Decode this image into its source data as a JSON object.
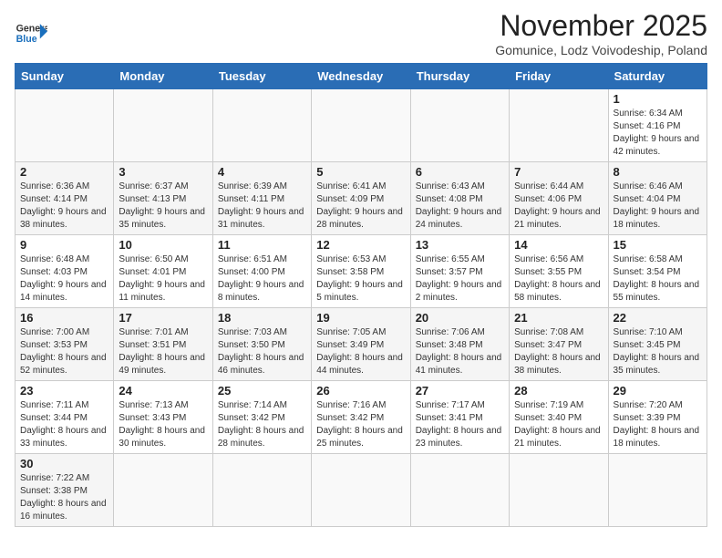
{
  "header": {
    "logo_general": "General",
    "logo_blue": "Blue",
    "month_title": "November 2025",
    "subtitle": "Gomunice, Lodz Voivodeship, Poland"
  },
  "days_of_week": [
    "Sunday",
    "Monday",
    "Tuesday",
    "Wednesday",
    "Thursday",
    "Friday",
    "Saturday"
  ],
  "weeks": [
    {
      "days": [
        {
          "num": "",
          "info": ""
        },
        {
          "num": "",
          "info": ""
        },
        {
          "num": "",
          "info": ""
        },
        {
          "num": "",
          "info": ""
        },
        {
          "num": "",
          "info": ""
        },
        {
          "num": "",
          "info": ""
        },
        {
          "num": "1",
          "info": "Sunrise: 6:34 AM\nSunset: 4:16 PM\nDaylight: 9 hours\nand 42 minutes."
        }
      ]
    },
    {
      "days": [
        {
          "num": "2",
          "info": "Sunrise: 6:36 AM\nSunset: 4:14 PM\nDaylight: 9 hours\nand 38 minutes."
        },
        {
          "num": "3",
          "info": "Sunrise: 6:37 AM\nSunset: 4:13 PM\nDaylight: 9 hours\nand 35 minutes."
        },
        {
          "num": "4",
          "info": "Sunrise: 6:39 AM\nSunset: 4:11 PM\nDaylight: 9 hours\nand 31 minutes."
        },
        {
          "num": "5",
          "info": "Sunrise: 6:41 AM\nSunset: 4:09 PM\nDaylight: 9 hours\nand 28 minutes."
        },
        {
          "num": "6",
          "info": "Sunrise: 6:43 AM\nSunset: 4:08 PM\nDaylight: 9 hours\nand 24 minutes."
        },
        {
          "num": "7",
          "info": "Sunrise: 6:44 AM\nSunset: 4:06 PM\nDaylight: 9 hours\nand 21 minutes."
        },
        {
          "num": "8",
          "info": "Sunrise: 6:46 AM\nSunset: 4:04 PM\nDaylight: 9 hours\nand 18 minutes."
        }
      ]
    },
    {
      "days": [
        {
          "num": "9",
          "info": "Sunrise: 6:48 AM\nSunset: 4:03 PM\nDaylight: 9 hours\nand 14 minutes."
        },
        {
          "num": "10",
          "info": "Sunrise: 6:50 AM\nSunset: 4:01 PM\nDaylight: 9 hours\nand 11 minutes."
        },
        {
          "num": "11",
          "info": "Sunrise: 6:51 AM\nSunset: 4:00 PM\nDaylight: 9 hours\nand 8 minutes."
        },
        {
          "num": "12",
          "info": "Sunrise: 6:53 AM\nSunset: 3:58 PM\nDaylight: 9 hours\nand 5 minutes."
        },
        {
          "num": "13",
          "info": "Sunrise: 6:55 AM\nSunset: 3:57 PM\nDaylight: 9 hours\nand 2 minutes."
        },
        {
          "num": "14",
          "info": "Sunrise: 6:56 AM\nSunset: 3:55 PM\nDaylight: 8 hours\nand 58 minutes."
        },
        {
          "num": "15",
          "info": "Sunrise: 6:58 AM\nSunset: 3:54 PM\nDaylight: 8 hours\nand 55 minutes."
        }
      ]
    },
    {
      "days": [
        {
          "num": "16",
          "info": "Sunrise: 7:00 AM\nSunset: 3:53 PM\nDaylight: 8 hours\nand 52 minutes."
        },
        {
          "num": "17",
          "info": "Sunrise: 7:01 AM\nSunset: 3:51 PM\nDaylight: 8 hours\nand 49 minutes."
        },
        {
          "num": "18",
          "info": "Sunrise: 7:03 AM\nSunset: 3:50 PM\nDaylight: 8 hours\nand 46 minutes."
        },
        {
          "num": "19",
          "info": "Sunrise: 7:05 AM\nSunset: 3:49 PM\nDaylight: 8 hours\nand 44 minutes."
        },
        {
          "num": "20",
          "info": "Sunrise: 7:06 AM\nSunset: 3:48 PM\nDaylight: 8 hours\nand 41 minutes."
        },
        {
          "num": "21",
          "info": "Sunrise: 7:08 AM\nSunset: 3:47 PM\nDaylight: 8 hours\nand 38 minutes."
        },
        {
          "num": "22",
          "info": "Sunrise: 7:10 AM\nSunset: 3:45 PM\nDaylight: 8 hours\nand 35 minutes."
        }
      ]
    },
    {
      "days": [
        {
          "num": "23",
          "info": "Sunrise: 7:11 AM\nSunset: 3:44 PM\nDaylight: 8 hours\nand 33 minutes."
        },
        {
          "num": "24",
          "info": "Sunrise: 7:13 AM\nSunset: 3:43 PM\nDaylight: 8 hours\nand 30 minutes."
        },
        {
          "num": "25",
          "info": "Sunrise: 7:14 AM\nSunset: 3:42 PM\nDaylight: 8 hours\nand 28 minutes."
        },
        {
          "num": "26",
          "info": "Sunrise: 7:16 AM\nSunset: 3:42 PM\nDaylight: 8 hours\nand 25 minutes."
        },
        {
          "num": "27",
          "info": "Sunrise: 7:17 AM\nSunset: 3:41 PM\nDaylight: 8 hours\nand 23 minutes."
        },
        {
          "num": "28",
          "info": "Sunrise: 7:19 AM\nSunset: 3:40 PM\nDaylight: 8 hours\nand 21 minutes."
        },
        {
          "num": "29",
          "info": "Sunrise: 7:20 AM\nSunset: 3:39 PM\nDaylight: 8 hours\nand 18 minutes."
        }
      ]
    },
    {
      "days": [
        {
          "num": "30",
          "info": "Sunrise: 7:22 AM\nSunset: 3:38 PM\nDaylight: 8 hours\nand 16 minutes."
        },
        {
          "num": "",
          "info": ""
        },
        {
          "num": "",
          "info": ""
        },
        {
          "num": "",
          "info": ""
        },
        {
          "num": "",
          "info": ""
        },
        {
          "num": "",
          "info": ""
        },
        {
          "num": "",
          "info": ""
        }
      ]
    }
  ]
}
